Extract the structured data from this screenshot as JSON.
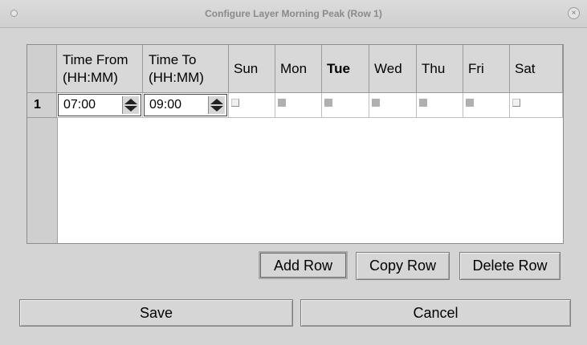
{
  "window": {
    "title": "Configure Layer Morning Peak (Row 1)",
    "close_glyph": "×"
  },
  "table": {
    "headers": {
      "time_from_line1": "Time From",
      "time_from_line2": "(HH:MM)",
      "time_to_line1": "Time To",
      "time_to_line2": "(HH:MM)",
      "sun": "Sun",
      "mon": "Mon",
      "tue": "Tue",
      "wed": "Wed",
      "thu": "Thu",
      "fri": "Fri",
      "sat": "Sat"
    },
    "rows": [
      {
        "number": "1",
        "time_from": "07:00",
        "time_to": "09:00",
        "days": {
          "sun": false,
          "mon": true,
          "tue": true,
          "wed": true,
          "thu": true,
          "fri": true,
          "sat": false
        }
      }
    ]
  },
  "buttons": {
    "add_row": "Add Row",
    "copy_row": "Copy Row",
    "delete_row": "Delete Row",
    "save": "Save",
    "cancel": "Cancel"
  },
  "colors": {
    "background": "#d4d4d4",
    "title_text": "#8a8a8a",
    "checked_box": "#b0b0b0"
  }
}
